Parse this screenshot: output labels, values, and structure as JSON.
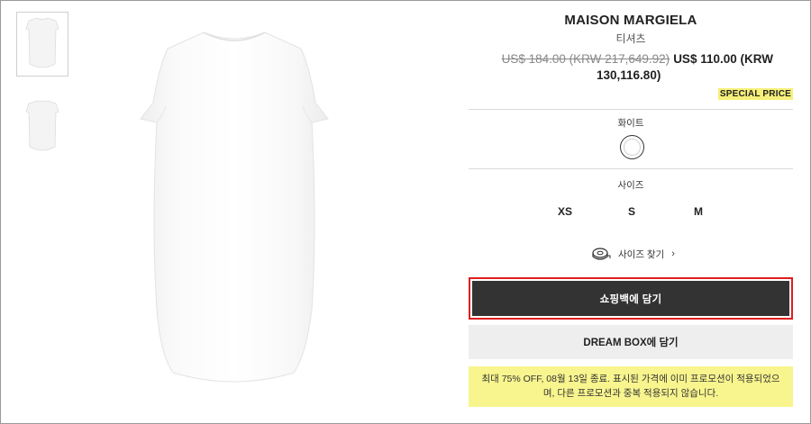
{
  "product": {
    "brand": "MAISON MARGIELA",
    "category": "티셔츠",
    "price_old": "US$ 184.00 (KRW 217,649.92)",
    "price_new_line1": "US$ 110.00 (KRW",
    "price_new_line2": "130,116.80)",
    "special_label": "SPECIAL PRICE"
  },
  "color": {
    "label": "화이트",
    "swatch_hex": "#ffffff"
  },
  "size": {
    "label": "사이즈",
    "options": [
      "XS",
      "S",
      "M"
    ],
    "guide_label": "사이즈 찾기"
  },
  "actions": {
    "add_to_bag": "쇼핑백에 담기",
    "dream_box": "DREAM BOX에 담기"
  },
  "promo": {
    "text": "최대 75% OFF, 08월 13일 종료. 표시된 가격에 이미 프로모션이 적용되었으며, 다른 프로모션과 중복 적용되지 않습니다."
  },
  "colors": {
    "primary_button": "#333333",
    "highlight_border": "#e01e1e",
    "promo_bg": "#f8f58e",
    "special_bg": "#f6f07a"
  }
}
